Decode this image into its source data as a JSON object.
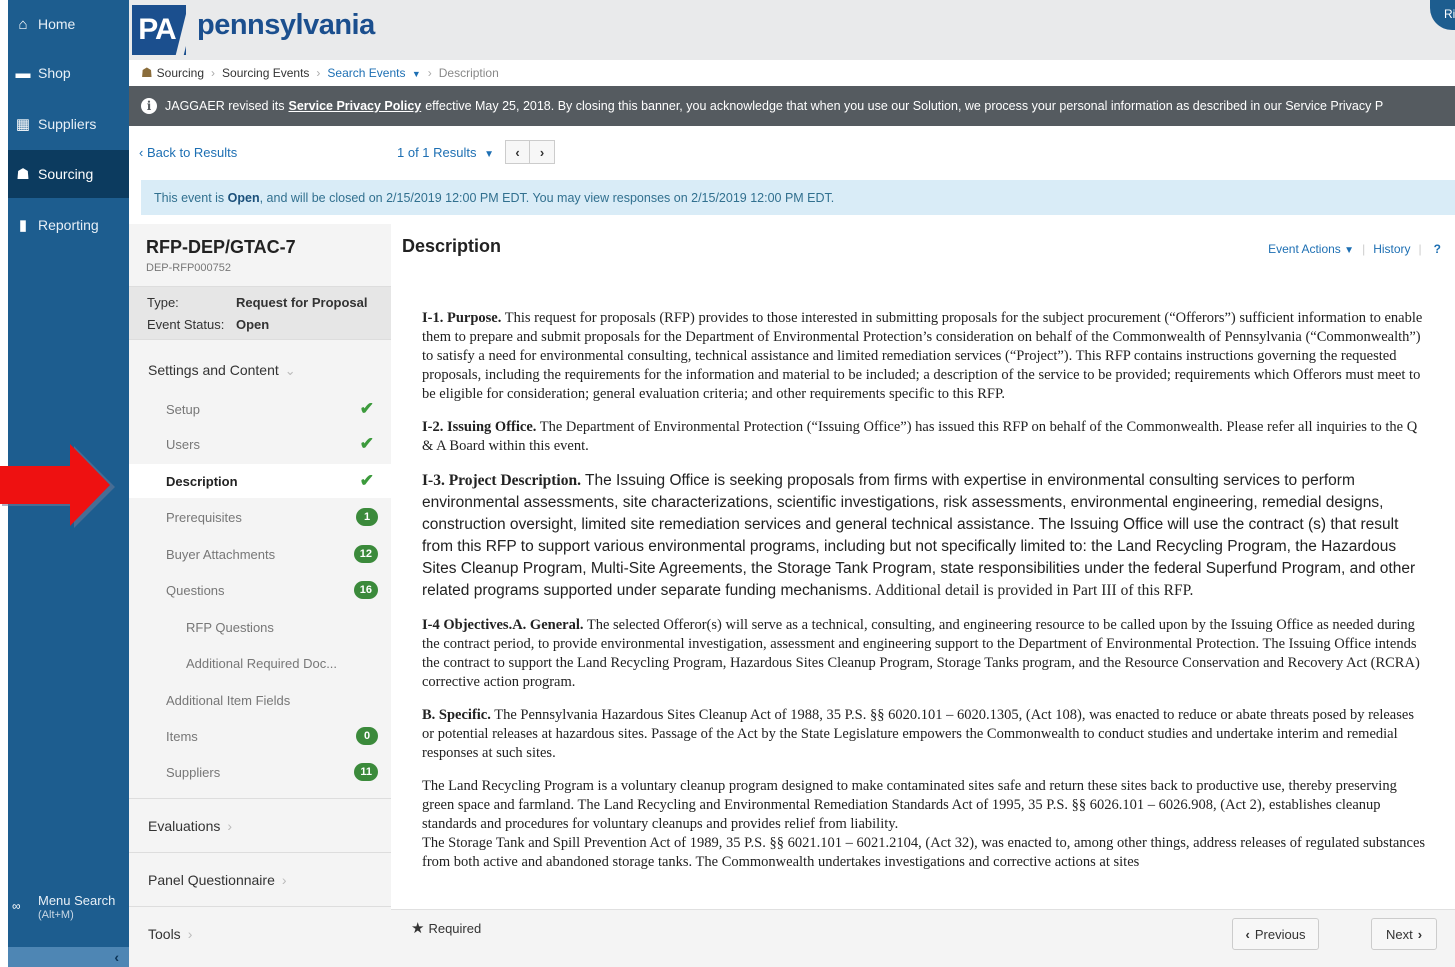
{
  "nav": {
    "items": [
      {
        "label": "Home",
        "icon": "home-icon"
      },
      {
        "label": "Shop",
        "icon": "cart-icon"
      },
      {
        "label": "Suppliers",
        "icon": "building-icon"
      },
      {
        "label": "Sourcing",
        "icon": "sourcing-icon"
      },
      {
        "label": "Reporting",
        "icon": "bar-chart-icon"
      }
    ],
    "menu_search": "Menu Search",
    "menu_search_shortcut": "(Alt+M)"
  },
  "header": {
    "logo_abbr": "PA",
    "logo_text": "pennsylvania",
    "user_initials": "Ri"
  },
  "breadcrumb": {
    "items": [
      "Sourcing",
      "Sourcing Events",
      "Search Events",
      "Description"
    ]
  },
  "banner": {
    "prefix": "JAGGAER revised its",
    "link": "Service Privacy Policy",
    "suffix": "effective May 25, 2018. By closing this banner, you acknowledge that when you use our Solution, we process your personal information as described in our Service Privacy P"
  },
  "results": {
    "back_label": "Back to Results",
    "count_label": "1 of 1 Results"
  },
  "status": {
    "prefix": "This event is",
    "state": "Open",
    "suffix": ", and will be closed on 2/15/2019 12:00 PM EDT. You may view responses on 2/15/2019 12:00 PM EDT."
  },
  "event": {
    "title": "RFP-DEP/GTAC-7",
    "number": "DEP-RFP000752",
    "type_label": "Type:",
    "type_value": "Request for Proposal",
    "status_label": "Event Status:",
    "status_value": "Open"
  },
  "sidebar": {
    "settings_label": "Settings and Content",
    "items": [
      {
        "label": "Setup",
        "mark": "check"
      },
      {
        "label": "Users",
        "mark": "check"
      },
      {
        "label": "Description",
        "mark": "check"
      },
      {
        "label": "Prerequisites",
        "badge": "1"
      },
      {
        "label": "Buyer Attachments",
        "badge": "12"
      },
      {
        "label": "Questions",
        "badge": "16"
      },
      {
        "label": "RFP Questions"
      },
      {
        "label": "Additional Required Doc..."
      },
      {
        "label": "Additional Item Fields"
      },
      {
        "label": "Items",
        "badge": "0"
      },
      {
        "label": "Suppliers",
        "badge": "11"
      }
    ],
    "sections": [
      "Evaluations",
      "Panel Questionnaire",
      "Tools"
    ]
  },
  "main": {
    "title": "Description",
    "event_actions": "Event Actions",
    "history": "History",
    "help": "?",
    "paragraphs": [
      {
        "head": "I-1.  Purpose.",
        "text": " This request for proposals (RFP) provides to those interested in submitting proposals for the subject procurement (“Offerors”) sufficient information to enable them to prepare and submit proposals for the Department of Environmental Protection’s consideration on behalf of the Commonwealth of Pennsylvania (“Commonwealth”) to satisfy a need for environmental consulting, technical assistance and limited remediation services (“Project”). This RFP contains instructions governing the requested proposals, including the requirements for the information and material to be included; a description of the service to be provided; requirements which Offerors must meet to be eligible for consideration; general evaluation criteria; and other requirements specific to this RFP."
      },
      {
        "head": "I-2. Issuing Office.",
        "text": " The Department of Environmental Protection (“Issuing Office”) has issued this RFP on behalf of the Commonwealth. Please refer all inquiries to the Q & A Board within this event."
      },
      {
        "head": "I-3. Project Description.",
        "text": " The Issuing Office is seeking proposals from firms with expertise in environmental consulting services to perform environmental assessments, site characterizations, scientific investigations, risk assessments, environmental engineering, remedial designs, construction oversight, limited site remediation services and general technical assistance. The Issuing Office will use the contract (s) that result from this RFP to support various environmental programs, including but not specifically limited to: the Land Recycling Program, the Hazardous Sites Cleanup Program, Multi-Site Agreements, the Storage Tank Program, state responsibilities under the federal Superfund Program, and other related programs supported under separate funding mechanisms.",
        "tail": " Additional detail is provided in Part III of this RFP."
      },
      {
        "head": "I-4 Objectives.A. General.",
        "text": " The selected Offeror(s) will serve as a technical, consulting, and engineering resource to be called upon by the Issuing Office as needed during the contract period, to provide environmental investigation, assessment and engineering support to the Department of Environmental Protection. The Issuing Office intends the contract to support the Land Recycling Program, Hazardous Sites Cleanup Program, Storage Tanks program, and the Resource Conservation and Recovery Act (RCRA) corrective action program."
      },
      {
        "head": "B. Specific.",
        "text": " The Pennsylvania Hazardous Sites Cleanup Act of 1988, 35 P.S. §§ 6020.101 – 6020.1305, (Act 108), was enacted to reduce or abate threats posed by releases or potential releases at hazardous sites. Passage of the Act by the State Legislature empowers the Commonwealth to conduct studies and undertake interim and remedial responses at such sites."
      },
      {
        "head": "",
        "text": "The Land Recycling Program is a voluntary cleanup program designed to make contaminated sites safe and return these sites back to productive use, thereby preserving green space and farmland. The Land Recycling and Environmental Remediation Standards Act of 1995, 35 P.S. §§ 6026.101 – 6026.908, (Act 2), establishes cleanup standards and procedures for voluntary cleanups and provides relief from liability."
      },
      {
        "head": "",
        "text": "The Storage Tank and Spill Prevention Act of 1989, 35 P.S. §§ 6021.101 – 6021.2104, (Act 32), was enacted to, among other things, address releases of regulated substances from both active and abandoned storage tanks. The Commonwealth undertakes investigations and corrective actions at sites"
      }
    ]
  },
  "footer": {
    "required_label": "Required",
    "previous_label": "Previous",
    "next_label": "Next"
  }
}
